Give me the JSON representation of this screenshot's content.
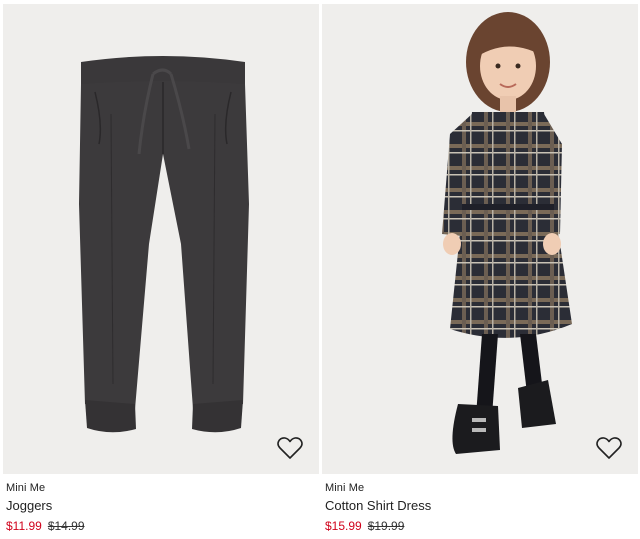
{
  "products": [
    {
      "collection": "Mini Me",
      "name": "Joggers",
      "sale_price": "$11.99",
      "original_price": "$14.99",
      "favorite_icon": "heart-outline-icon"
    },
    {
      "collection": "Mini Me",
      "name": "Cotton Shirt Dress",
      "sale_price": "$15.99",
      "original_price": "$19.99",
      "favorite_icon": "heart-outline-icon"
    }
  ],
  "colors": {
    "image_bg": "#efeeec",
    "sale_price": "#d0021b",
    "text": "#222222"
  }
}
